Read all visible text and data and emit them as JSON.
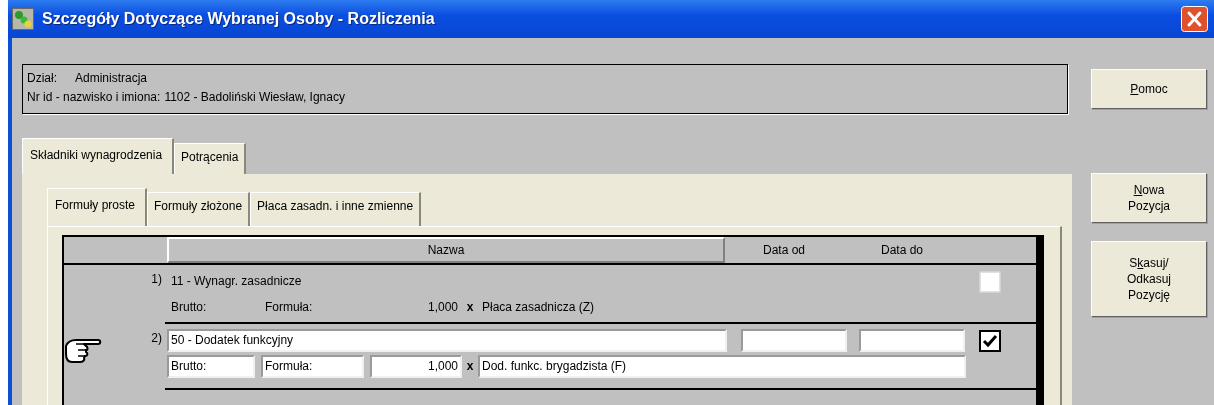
{
  "window": {
    "title": "Szczegóły Dotyczące Wybranej Osoby - Rozliczenia"
  },
  "info": {
    "department_label": "Dział:",
    "department": "Administracja",
    "person_label": "Nr id - nazwisko i imiona:",
    "person": "1102 - Badoliński Wiesław, Ignacy"
  },
  "tabs": [
    {
      "label": "Składniki wynagrodzenia",
      "selected": true
    },
    {
      "label": "Potrącenia",
      "selected": false
    }
  ],
  "subtabs": [
    {
      "label": "Formuły proste",
      "selected": true
    },
    {
      "label": "Formuły złożone",
      "selected": false
    },
    {
      "label": "Płaca zasadn. i inne zmienne",
      "selected": false
    }
  ],
  "table": {
    "columns": [
      "Nazwa",
      "Data od",
      "Data do"
    ],
    "rows": [
      {
        "number": "1)",
        "name": "11 - Wynagr. zasadnicze",
        "gross_label": "Brutto:",
        "formula_label": "Formuła:",
        "factor": "1,000",
        "operator": "x",
        "formula": "Płaca zasadnicza (Z)",
        "checked": false,
        "selected": false
      },
      {
        "number": "2)",
        "name": "50 - Dodatek funkcyjny",
        "gross_label": "Brutto:",
        "formula_label": "Formuła:",
        "factor": "1,000",
        "operator": "x",
        "formula": "Dod. funkc. brygadzista (F)",
        "checked": true,
        "selected": true
      }
    ]
  },
  "buttons": [
    {
      "lines": [
        {
          "key": "P",
          "after": "omoc"
        }
      ]
    },
    {
      "lines": [
        {
          "key": "N",
          "after": "owa"
        },
        {
          "text": "Pozycja"
        }
      ]
    },
    {
      "lines": [
        {
          "before": "S",
          "key": "k",
          "after": "asuj/"
        },
        {
          "text": "Odkasuj"
        },
        {
          "text": "Pozycję"
        }
      ]
    }
  ]
}
